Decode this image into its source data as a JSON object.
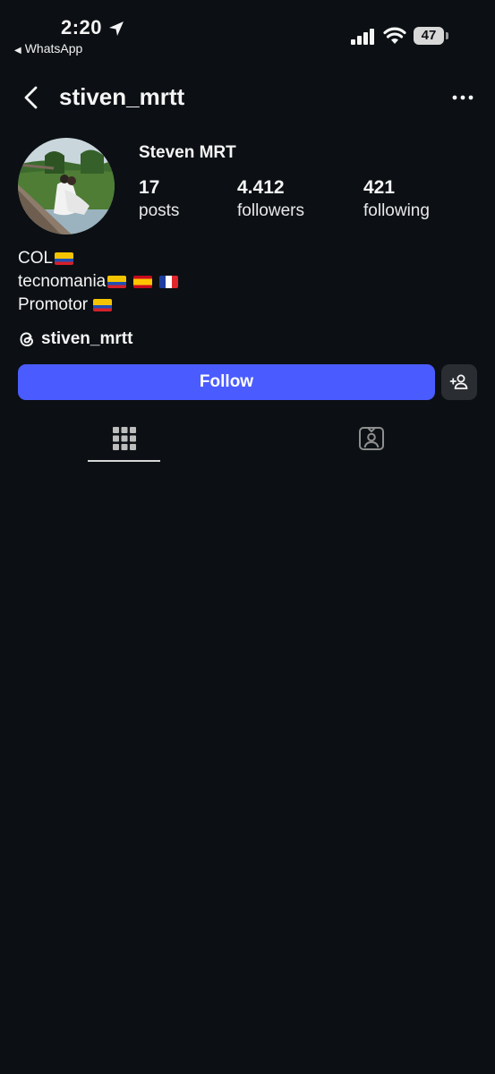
{
  "status_bar": {
    "time": "2:20",
    "back_app": "WhatsApp",
    "battery": "47"
  },
  "header": {
    "username": "stiven_mrtt"
  },
  "profile": {
    "display_name": "Steven MRT",
    "stats": {
      "posts": {
        "value": "17",
        "label": "posts"
      },
      "followers": {
        "value": "4.412",
        "label": "followers"
      },
      "following": {
        "value": "421",
        "label": "following"
      }
    },
    "bio": {
      "line1": "COL",
      "line2": "tecnomania",
      "line3": "Promotor"
    },
    "threads_handle": "stiven_mrtt"
  },
  "actions": {
    "follow_label": "Follow"
  },
  "tabs": [
    "grid-icon",
    "tagged-icon"
  ],
  "colors": {
    "background": "#0c1014",
    "follow_button": "#4a5cff",
    "secondary_button": "#2a2d31"
  }
}
